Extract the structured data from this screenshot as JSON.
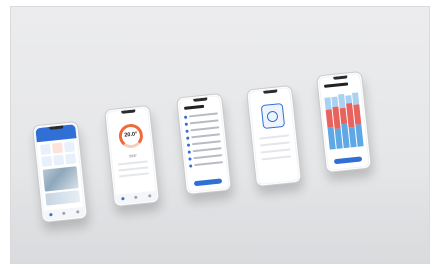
{
  "scene": {
    "background_color": "#e8e9eb",
    "accent_blue": "#2f6fd6",
    "accent_orange": "#ef6a3a"
  },
  "phones": [
    {
      "screen": "home",
      "icon": "home-icon"
    },
    {
      "screen": "thermostat",
      "temperature": "20.0°",
      "secondary": "23.5°"
    },
    {
      "screen": "list"
    },
    {
      "screen": "fan",
      "icon": "fan-icon"
    },
    {
      "screen": "chart"
    }
  ]
}
